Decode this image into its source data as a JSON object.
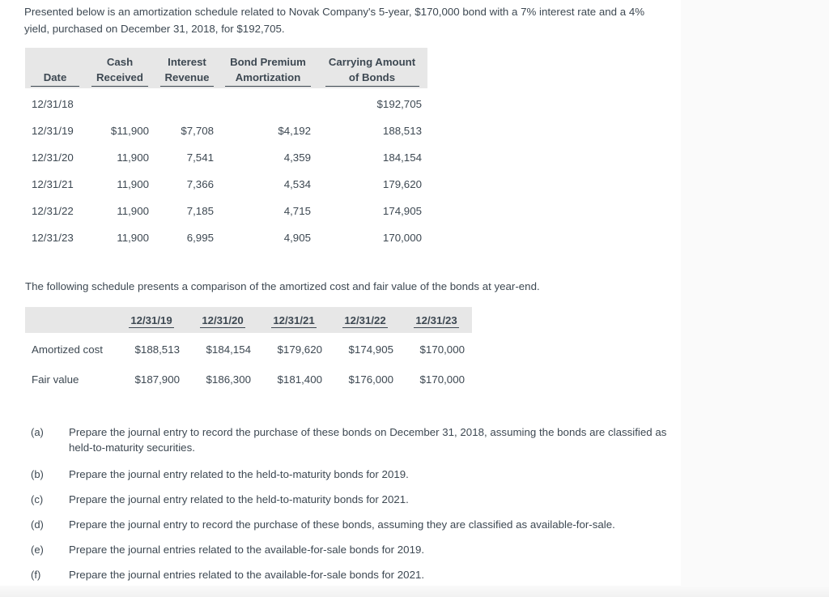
{
  "intro": {
    "paragraph1": "Presented below is an amortization schedule related to Novak Company's 5-year, $170,000 bond with a 7% interest rate and a 4% yield, purchased on December 31, 2018, for $192,705.",
    "paragraph2": "The following schedule presents a comparison of the amortized cost and fair value of the bonds at year-end."
  },
  "amortization_table": {
    "headers": [
      {
        "line1": "",
        "line2": "Date"
      },
      {
        "line1": "Cash",
        "line2": "Received"
      },
      {
        "line1": "Interest",
        "line2": "Revenue"
      },
      {
        "line1": "Bond Premium",
        "line2": "Amortization"
      },
      {
        "line1": "Carrying Amount",
        "line2": "of Bonds"
      }
    ],
    "rows": [
      {
        "date": "12/31/18",
        "cash_received": "",
        "interest_revenue": "",
        "bond_premium_amortization": "",
        "carrying_amount": "$192,705"
      },
      {
        "date": "12/31/19",
        "cash_received": "$11,900",
        "interest_revenue": "$7,708",
        "bond_premium_amortization": "$4,192",
        "carrying_amount": "188,513"
      },
      {
        "date": "12/31/20",
        "cash_received": "11,900",
        "interest_revenue": "7,541",
        "bond_premium_amortization": "4,359",
        "carrying_amount": "184,154"
      },
      {
        "date": "12/31/21",
        "cash_received": "11,900",
        "interest_revenue": "7,366",
        "bond_premium_amortization": "4,534",
        "carrying_amount": "179,620"
      },
      {
        "date": "12/31/22",
        "cash_received": "11,900",
        "interest_revenue": "7,185",
        "bond_premium_amortization": "4,715",
        "carrying_amount": "174,905"
      },
      {
        "date": "12/31/23",
        "cash_received": "11,900",
        "interest_revenue": "6,995",
        "bond_premium_amortization": "4,905",
        "carrying_amount": "170,000"
      }
    ]
  },
  "comparison_table": {
    "headers": [
      "",
      "12/31/19",
      "12/31/20",
      "12/31/21",
      "12/31/22",
      "12/31/23"
    ],
    "rows": [
      {
        "label": "Amortized cost",
        "values": [
          "$188,513",
          "$184,154",
          "$179,620",
          "$174,905",
          "$170,000"
        ]
      },
      {
        "label": "Fair value",
        "values": [
          "$187,900",
          "$186,300",
          "$181,400",
          "$176,000",
          "$170,000"
        ]
      }
    ]
  },
  "questions": [
    {
      "label": "(a)",
      "text": "Prepare the journal entry to record the purchase of these bonds on December 31, 2018, assuming the bonds are classified as held-to-maturity securities."
    },
    {
      "label": "(b)",
      "text": "Prepare the journal entry related to the held-to-maturity bonds for 2019."
    },
    {
      "label": "(c)",
      "text": "Prepare the journal entry related to the held-to-maturity bonds for 2021."
    },
    {
      "label": "(d)",
      "text": "Prepare the journal entry to record the purchase of these bonds, assuming they are classified as available-for-sale."
    },
    {
      "label": "(e)",
      "text": "Prepare the journal entries related to the available-for-sale bonds for 2019."
    },
    {
      "label": "(f)",
      "text": "Prepare the journal entries related to the available-for-sale bonds for 2021."
    }
  ],
  "colors": {
    "text": "#3d4852",
    "header_background": "#e7e7e7",
    "page_background": "#fbfbfb",
    "sheet_background": "#ffffff"
  }
}
